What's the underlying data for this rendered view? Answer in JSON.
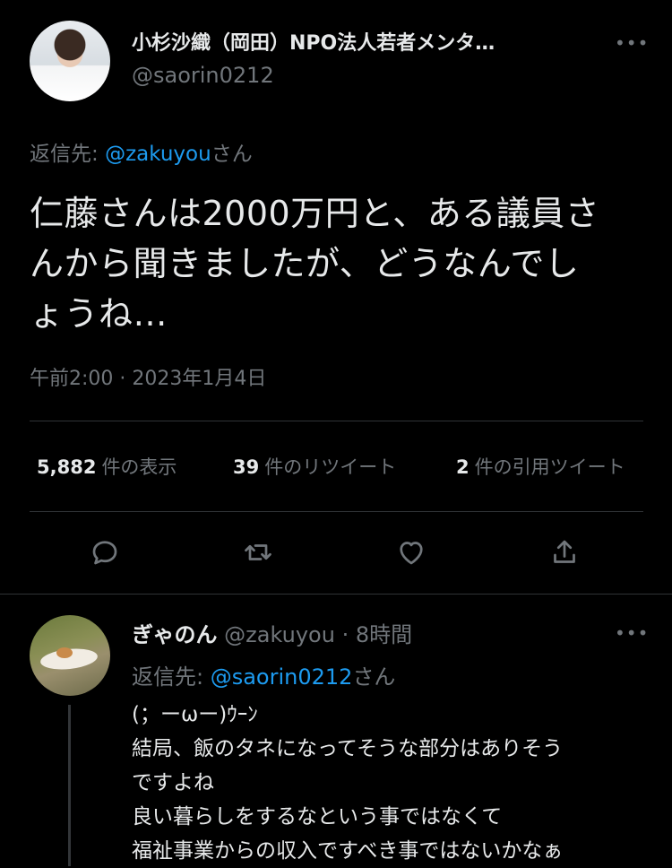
{
  "tweet": {
    "author_name": "小杉沙織（岡田）NPO法人若者メンタ…",
    "handle": "@saorin0212",
    "more": "•••",
    "reply_prefix": "返信先: ",
    "reply_handle": "@zakuyou",
    "reply_suffix": "さん",
    "text_lines": [
      "仁藤さんは2000万円と、ある議員さ",
      "んから聞きましたが、どうなんでし",
      "ょうね…"
    ],
    "timestamp": "午前2:00 · 2023年1月4日"
  },
  "stats": {
    "views_count": "5,882",
    "views_label": "件の表示",
    "retweets_count": "39",
    "retweets_label": "件のリツイート",
    "quotes_count": "2",
    "quotes_label": "件の引用ツイート"
  },
  "actions": {
    "icons": [
      "reply-icon",
      "retweet-icon",
      "like-icon",
      "share-icon"
    ]
  },
  "reply": {
    "author_name": "ぎゃのん",
    "handle_time": "@zakuyou · 8時間",
    "more": "•••",
    "reply_prefix": "返信先: ",
    "reply_handle": "@saorin0212",
    "reply_suffix": "さん",
    "lines": [
      "(；ーωー)ｳｰﾝ",
      "結局、飯のタネになってそうな部分はありそう",
      "ですよね",
      "良い暮らしをするなという事ではなくて",
      "福祉事業からの収入ですべき事ではないかなぁ"
    ]
  },
  "colors": {
    "background": "#000000",
    "text": "#e7e9ea",
    "muted": "#71767b",
    "link": "#1d9bf0",
    "divider": "#2f3336"
  }
}
